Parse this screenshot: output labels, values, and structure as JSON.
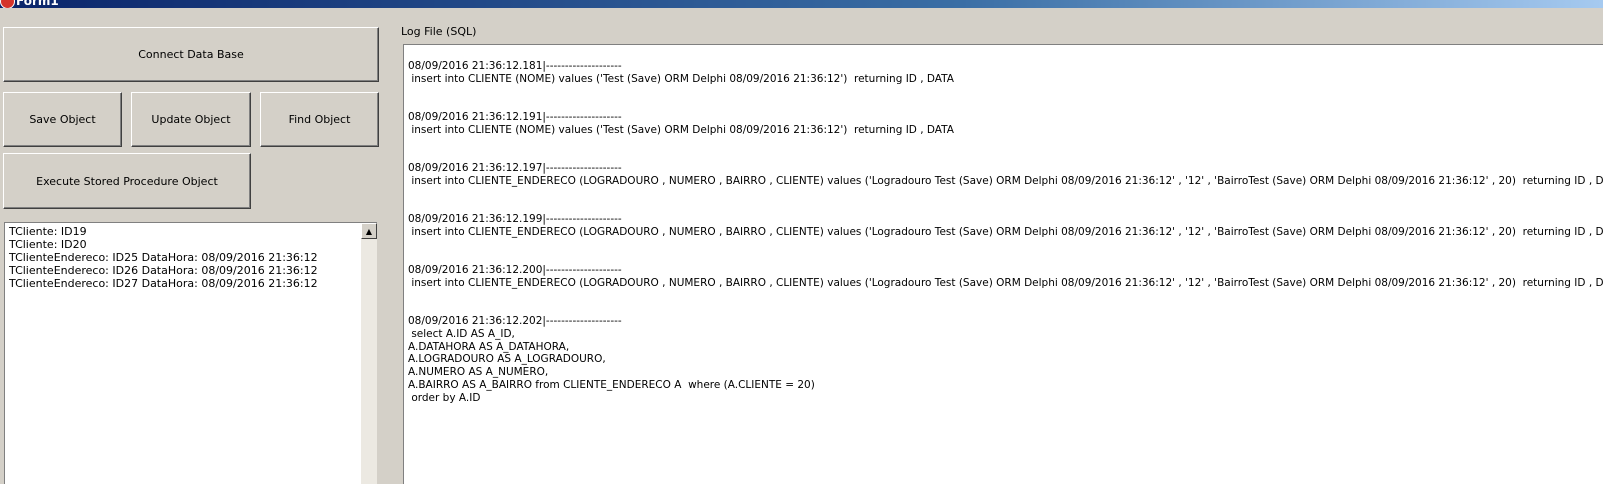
{
  "window": {
    "title": "Form1"
  },
  "buttons": {
    "connect": "Connect Data Base",
    "save": "Save Object",
    "update": "Update Object",
    "find": "Find Object",
    "execute_sp": "Execute Stored Procedure Object"
  },
  "objects_memo": {
    "lines": [
      "TCliente: ID19",
      "TCliente: ID20",
      "TClienteEndereco: ID25 DataHora: 08/09/2016 21:36:12",
      "TClienteEndereco: ID26 DataHora: 08/09/2016 21:36:12",
      "TClienteEndereco: ID27 DataHora: 08/09/2016 21:36:12"
    ]
  },
  "log": {
    "label": "Log File (SQL)",
    "lines": [
      "08/09/2016 21:36:12.181|--------------------",
      " insert into CLIENTE (NOME) values ('Test (Save) ORM Delphi 08/09/2016 21:36:12')  returning ID , DATA",
      "",
      "",
      "08/09/2016 21:36:12.191|--------------------",
      " insert into CLIENTE (NOME) values ('Test (Save) ORM Delphi 08/09/2016 21:36:12')  returning ID , DATA",
      "",
      "",
      "08/09/2016 21:36:12.197|--------------------",
      " insert into CLIENTE_ENDERECO (LOGRADOURO , NUMERO , BAIRRO , CLIENTE) values ('Logradouro Test (Save) ORM Delphi 08/09/2016 21:36:12' , '12' , 'BairroTest (Save) ORM Delphi 08/09/2016 21:36:12' , 20)  returning ID , DATAHORA",
      "",
      "",
      "08/09/2016 21:36:12.199|--------------------",
      " insert into CLIENTE_ENDERECO (LOGRADOURO , NUMERO , BAIRRO , CLIENTE) values ('Logradouro Test (Save) ORM Delphi 08/09/2016 21:36:12' , '12' , 'BairroTest (Save) ORM Delphi 08/09/2016 21:36:12' , 20)  returning ID , DATAHORA",
      "",
      "",
      "08/09/2016 21:36:12.200|--------------------",
      " insert into CLIENTE_ENDERECO (LOGRADOURO , NUMERO , BAIRRO , CLIENTE) values ('Logradouro Test (Save) ORM Delphi 08/09/2016 21:36:12' , '12' , 'BairroTest (Save) ORM Delphi 08/09/2016 21:36:12' , 20)  returning ID , DATAHORA",
      "",
      "",
      "08/09/2016 21:36:12.202|--------------------",
      " select A.ID AS A_ID,",
      "A.DATAHORA AS A_DATAHORA,",
      "A.LOGRADOURO AS A_LOGRADOURO,",
      "A.NUMERO AS A_NUMERO,",
      "A.BAIRRO AS A_BAIRRO from CLIENTE_ENDERECO A  where (A.CLIENTE = 20)",
      " order by A.ID"
    ]
  },
  "colors": {
    "form_background": "#d4d0c8",
    "memo_background": "#ffffff",
    "titlebar_start": "#0a246a",
    "titlebar_end": "#a6caf0"
  }
}
